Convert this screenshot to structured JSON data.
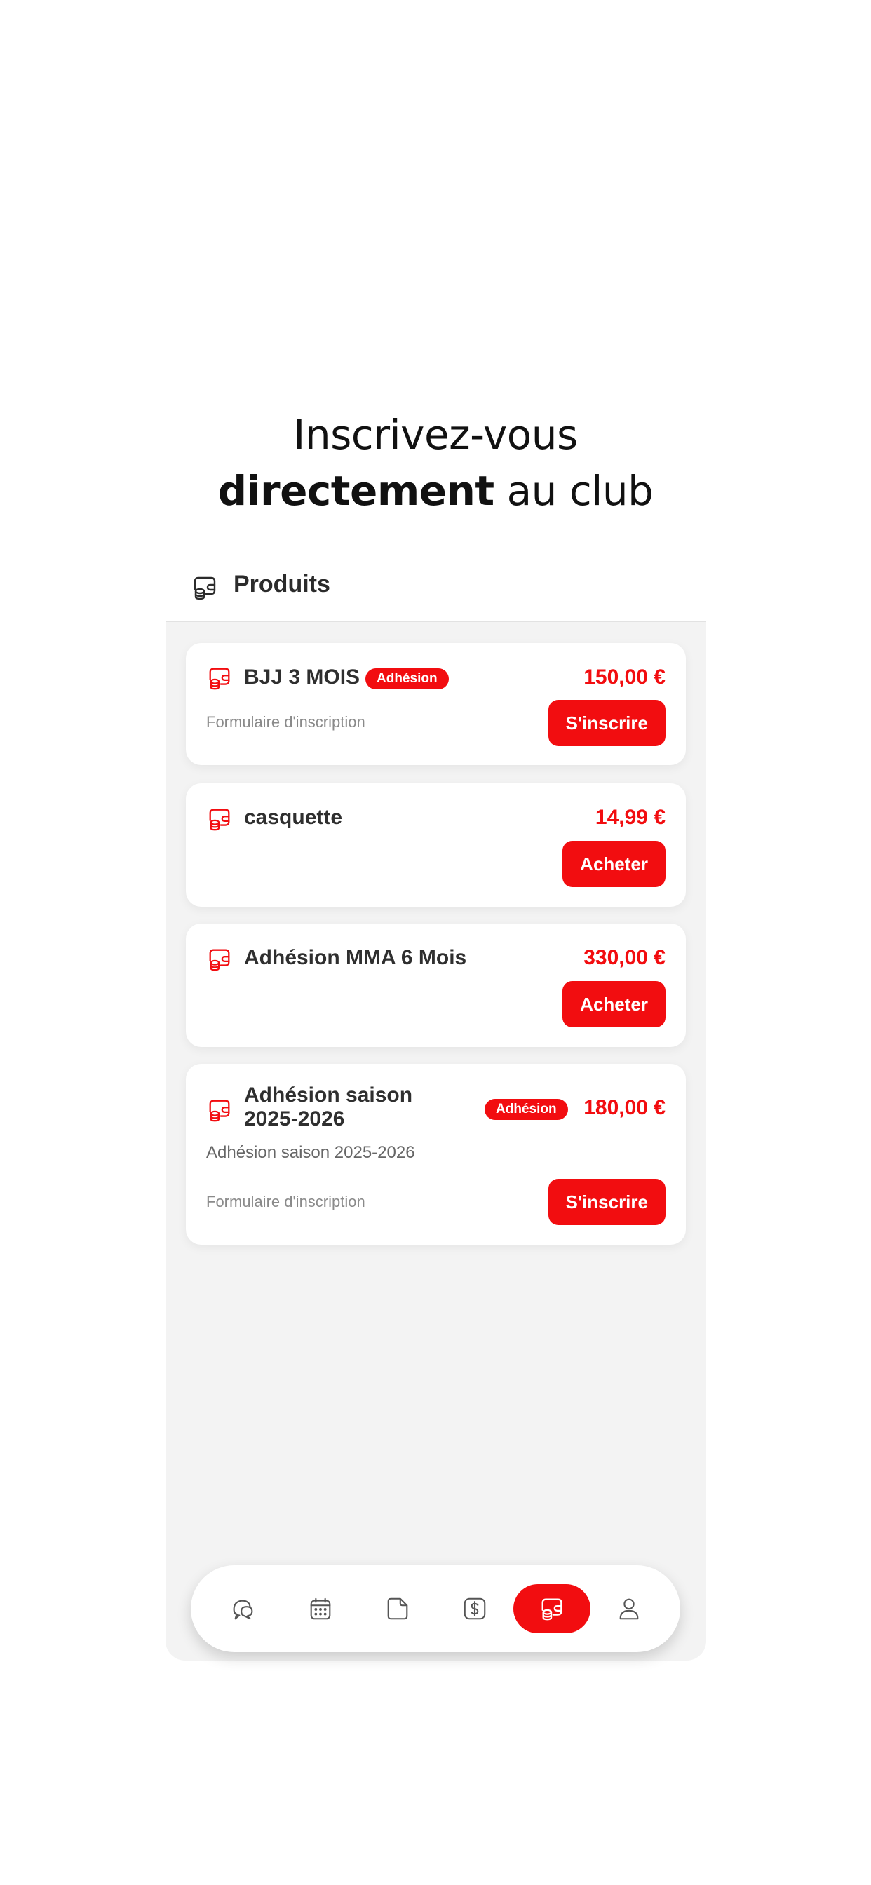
{
  "headline": {
    "line1": "Inscrivez-vous",
    "line2_bold": "directement",
    "line2_rest": " au club"
  },
  "header": {
    "title": "Produits",
    "icon": "coins-icon"
  },
  "products": [
    {
      "name": "BJJ 3 MOIS",
      "badge": "Adhésion",
      "price": "150,00 €",
      "description": "",
      "form_link": "Formulaire d'inscription",
      "action": "S'inscrire"
    },
    {
      "name": "casquette",
      "badge": "",
      "price": "14,99 €",
      "description": "",
      "form_link": "",
      "action": "Acheter"
    },
    {
      "name": "Adhésion MMA 6 Mois",
      "badge": "",
      "price": "330,00 €",
      "description": "",
      "form_link": "",
      "action": "Acheter"
    },
    {
      "name_line1": "Adhésion saison",
      "name_line2": "2025-2026",
      "badge": "Adhésion",
      "price": "180,00 €",
      "description": "Adhésion saison 2025-2026",
      "form_link": "Formulaire d'inscription",
      "action": "S'inscrire"
    }
  ],
  "nav": {
    "items": [
      {
        "icon": "chat-bubbles-icon"
      },
      {
        "icon": "calendar-icon"
      },
      {
        "icon": "document-icon"
      },
      {
        "icon": "dollar-icon"
      },
      {
        "icon": "coins-icon",
        "active": true
      },
      {
        "icon": "user-icon"
      }
    ]
  },
  "colors": {
    "accent": "#f20d10",
    "panel_background": "#f3f3f3",
    "text_dark": "#2f2f2f",
    "text_muted": "#8a8a8a"
  }
}
